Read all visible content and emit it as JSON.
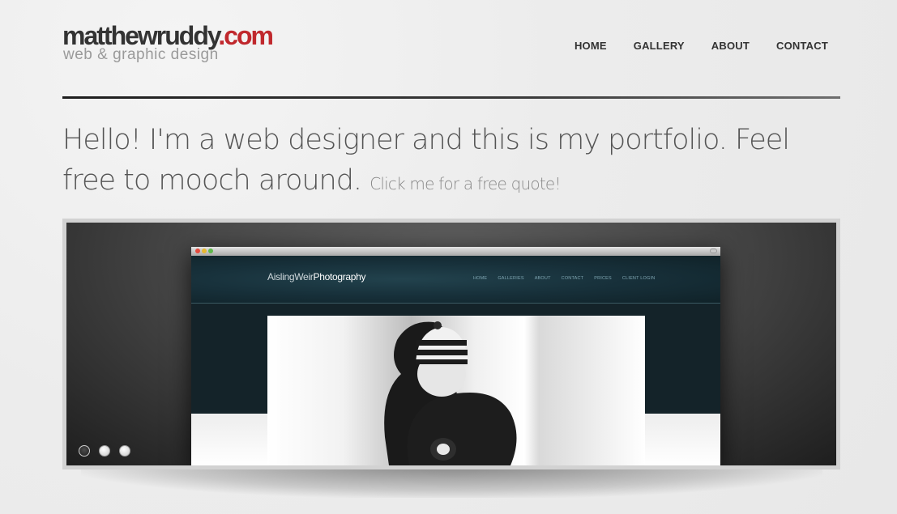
{
  "logo": {
    "name": "matthewruddy",
    "tld": ".com",
    "tagline": "web & graphic design"
  },
  "nav": [
    "HOME",
    "GALLERY",
    "ABOUT",
    "CONTACT"
  ],
  "intro": {
    "headline": "Hello! I'm a web designer and this is my portfolio. Feel free to mooch around.",
    "cta": "Click me for a free quote!"
  },
  "slide": {
    "site_logo_light": "AislingWeir",
    "site_logo_bold": "Photography",
    "site_nav": [
      "HOME",
      "GALLERIES",
      "ABOUT",
      "CONTACT",
      "PRICES",
      "CLIENT LOGIN"
    ]
  },
  "slider_dots": {
    "count": 3,
    "active_index": 0
  },
  "colors": {
    "accent": "#c0282d",
    "text_dark": "#333333",
    "tagline_gray": "#9a9a9a"
  }
}
